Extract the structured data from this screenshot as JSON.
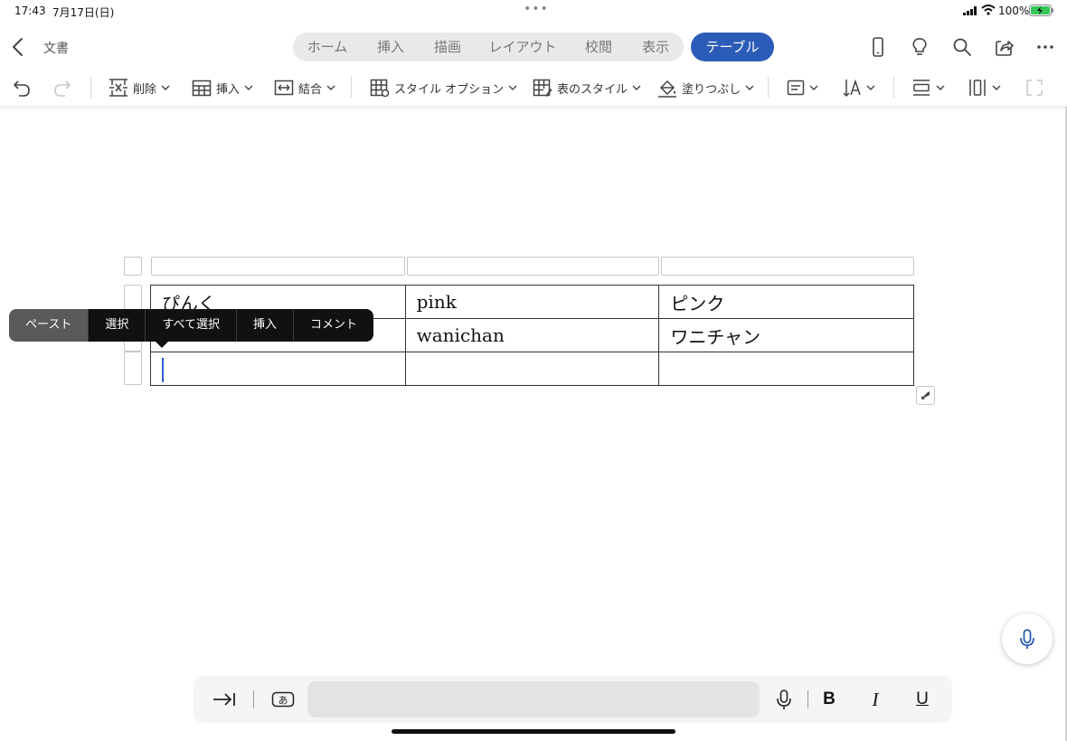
{
  "status_bar": {
    "time": "17:43",
    "date": "7月17日(日)",
    "dots": "•••",
    "battery": "100%"
  },
  "title_bar": {
    "doc_title": "文書"
  },
  "tabs": [
    {
      "label": "ホーム"
    },
    {
      "label": "挿入"
    },
    {
      "label": "描画"
    },
    {
      "label": "レイアウト"
    },
    {
      "label": "校閲"
    },
    {
      "label": "表示"
    }
  ],
  "active_tab": "テーブル",
  "ribbon": {
    "delete_label": "削除",
    "insert_label": "挿入",
    "merge_label": "結合",
    "style_options_label": "スタイル オプション",
    "table_style_label": "表のスタイル",
    "fill_label": "塗りつぶし"
  },
  "table": {
    "rows": [
      [
        "ぴんく",
        "pink",
        "ピンク"
      ],
      [
        "",
        "wanichan",
        "ワニチャン"
      ],
      [
        "",
        "",
        ""
      ]
    ]
  },
  "context_menu": {
    "items": [
      "ペースト",
      "選択",
      "すべて選択",
      "挿入",
      "コメント"
    ]
  },
  "colors": {
    "accent": "#2b5cb8",
    "caret": "#2f5fd6",
    "menu_bg": "#111111",
    "menu_highlight": "#5a5a5a"
  },
  "icons": [
    "back-icon",
    "phone-icon",
    "lightbulb-icon",
    "search-icon",
    "share-icon",
    "more-icon",
    "undo-icon",
    "redo-icon",
    "microphone-icon",
    "tab-key-icon",
    "kana-input-icon"
  ]
}
